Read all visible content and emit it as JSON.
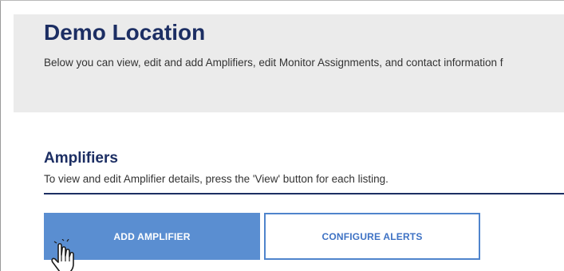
{
  "header": {
    "title": "Demo Location",
    "description": "Below you can view, edit and add Amplifiers, edit Monitor Assignments, and contact information f"
  },
  "amplifiers": {
    "heading": "Amplifiers",
    "instructions": "To view and edit Amplifier details, press the 'View' button for each listing."
  },
  "actions": {
    "add_amplifier": "ADD AMPLIFIER",
    "configure_alerts": "CONFIGURE ALERTS"
  },
  "cursor": {
    "icon": "hand-pointer-icon"
  },
  "colors": {
    "title": "#1c2e63",
    "banner_background": "#ebebeb",
    "primary_button": "#5a8ed1",
    "secondary_button_border": "#4f84cc",
    "secondary_button_text": "#3e72c4"
  }
}
